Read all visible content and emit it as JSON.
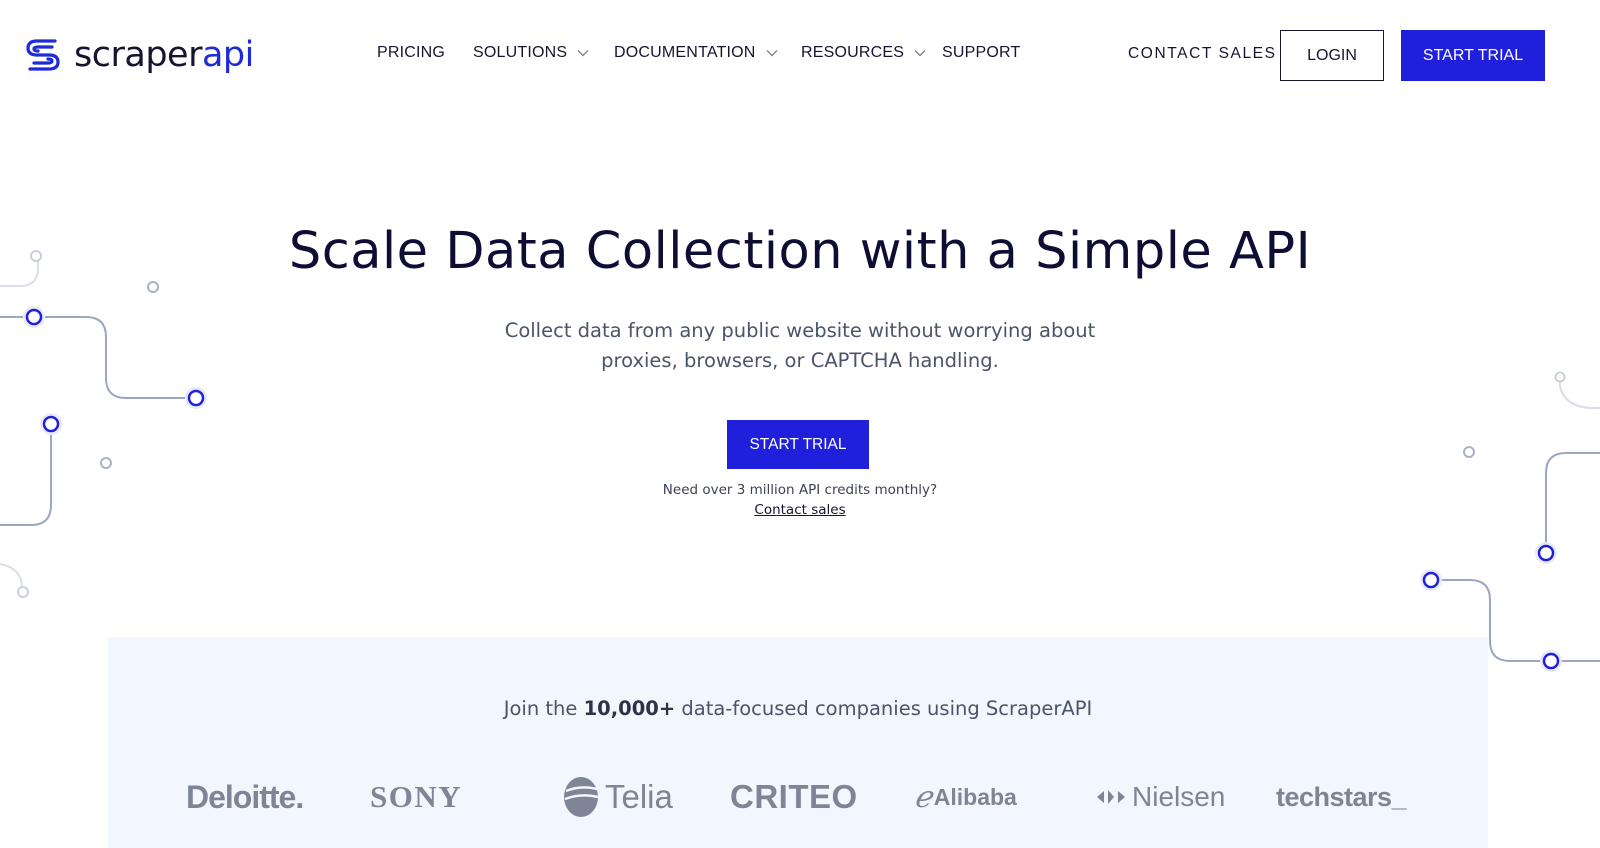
{
  "brand": {
    "name_part1": "scraper",
    "name_part2": "api",
    "logo_icon": "scraperapi-s-icon",
    "accent_color": "#1f1fdc",
    "text_color": "#0e0e35"
  },
  "nav": {
    "items": [
      {
        "label": "PRICING",
        "has_dropdown": false
      },
      {
        "label": "SOLUTIONS",
        "has_dropdown": true
      },
      {
        "label": "DOCUMENTATION",
        "has_dropdown": true
      },
      {
        "label": "RESOURCES",
        "has_dropdown": true
      },
      {
        "label": "SUPPORT",
        "has_dropdown": false
      }
    ],
    "dropdown_icon": "chevron-down-icon",
    "contact_sales": "CONTACT SALES",
    "login": "LOGIN",
    "start_trial": "START TRIAL"
  },
  "hero": {
    "title": "Scale Data Collection with a Simple API",
    "subtitle_line1": "Collect data from any public website without worrying about",
    "subtitle_line2": "proxies, browsers, or CAPTCHA handling.",
    "cta": "START TRIAL",
    "note": "Need over 3 million API credits monthly?",
    "note_link": "Contact sales"
  },
  "social_proof": {
    "text_before": "Join the ",
    "text_bold": "10,000+",
    "text_after": " data-focused companies using ScraperAPI",
    "background_color": "#f1f7fd",
    "logos": [
      "Deloitte.",
      "SONY",
      "Telia",
      "CRITEO",
      "Alibaba",
      "Nielsen",
      "techstars_"
    ]
  }
}
